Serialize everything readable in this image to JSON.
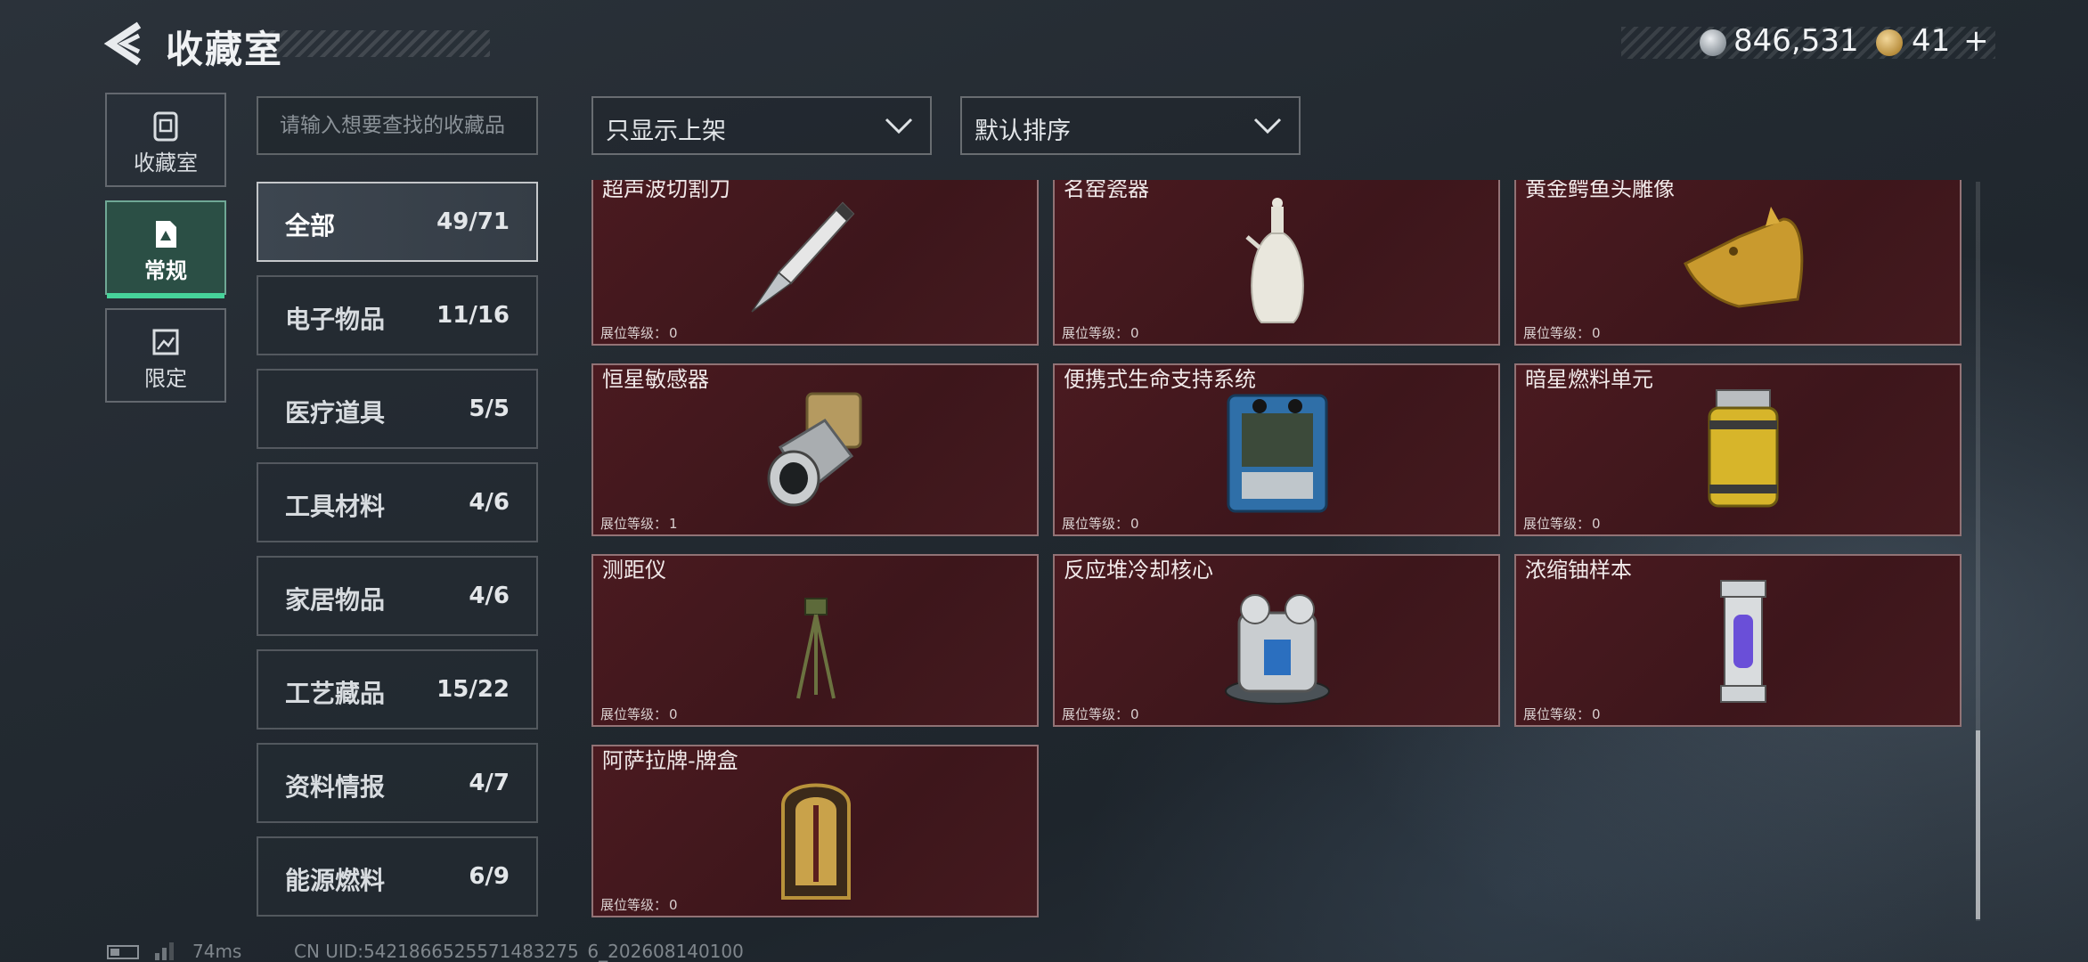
{
  "header": {
    "title": "收藏室",
    "currency1": "846,531",
    "currency2": "41",
    "add_symbol": "+"
  },
  "left_tabs": [
    {
      "label": "收藏室",
      "icon": "collection-icon",
      "active": false
    },
    {
      "label": "常规",
      "icon": "regular-icon",
      "active": true
    },
    {
      "label": "限定",
      "icon": "limited-icon",
      "active": false
    }
  ],
  "search": {
    "placeholder": "请输入想要查找的收藏品"
  },
  "filters": {
    "filter_label": "只显示上架",
    "sort_label": "默认排序"
  },
  "categories": [
    {
      "name": "全部",
      "count": "49/71",
      "active": true
    },
    {
      "name": "电子物品",
      "count": "11/16"
    },
    {
      "name": "医疗道具",
      "count": "5/5"
    },
    {
      "name": "工具材料",
      "count": "4/6"
    },
    {
      "name": "家居物品",
      "count": "4/6"
    },
    {
      "name": "工艺藏品",
      "count": "15/22"
    },
    {
      "name": "资料情报",
      "count": "4/7"
    },
    {
      "name": "能源燃料",
      "count": "6/9"
    }
  ],
  "level_label": "展位等级：",
  "items": [
    {
      "name": "超声波切割刀",
      "level": "0",
      "icon": "ultrasonic-knife-icon"
    },
    {
      "name": "名窑瓷器",
      "level": "0",
      "icon": "porcelain-vase-icon"
    },
    {
      "name": "黄金鳄鱼头雕像",
      "level": "0",
      "icon": "golden-crocodile-statue-icon"
    },
    {
      "name": "恒星敏感器",
      "level": "1",
      "icon": "star-sensor-icon"
    },
    {
      "name": "便携式生命支持系统",
      "level": "0",
      "icon": "life-support-icon"
    },
    {
      "name": "暗星燃料单元",
      "level": "0",
      "icon": "fuel-cell-icon"
    },
    {
      "name": "测距仪",
      "level": "0",
      "icon": "rangefinder-icon"
    },
    {
      "name": "反应堆冷却核心",
      "level": "0",
      "icon": "reactor-core-icon"
    },
    {
      "name": "浓缩铀样本",
      "level": "0",
      "icon": "uranium-sample-icon"
    },
    {
      "name": "阿萨拉牌-牌盒",
      "level": "0",
      "icon": "card-box-icon"
    }
  ],
  "footer": {
    "ping": "74ms",
    "uid": "CN UID:5421866525571483275  6_202608140100"
  }
}
